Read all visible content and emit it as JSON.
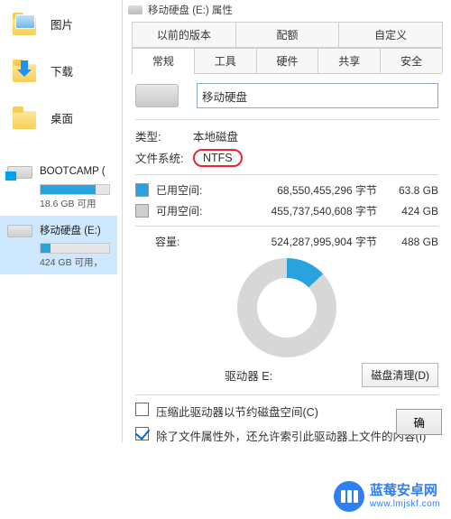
{
  "sidebar": {
    "items": [
      {
        "label": "图片"
      },
      {
        "label": "下载"
      },
      {
        "label": "桌面"
      }
    ],
    "drives": [
      {
        "name": "BOOTCAMP (",
        "sub": "18.6 GB 可用",
        "fill": 80,
        "selected": false,
        "hasWin": true
      },
      {
        "name": "移动硬盘 (E:)",
        "sub": "424 GB 可用，",
        "fill": 14,
        "selected": true,
        "hasWin": false
      }
    ]
  },
  "window": {
    "title": "移动硬盘 (E:) 属性"
  },
  "tabs_top": [
    "以前的版本",
    "配额",
    "自定义"
  ],
  "tabs_bottom": [
    "常规",
    "工具",
    "硬件",
    "共享",
    "安全"
  ],
  "active_tab": "常规",
  "general": {
    "name_value": "移动硬盘",
    "type_label": "类型:",
    "type_value": "本地磁盘",
    "fs_label": "文件系统:",
    "fs_value": "NTFS",
    "used_label": "已用空间:",
    "used_bytes": "68,550,455,296 字节",
    "used_gb": "63.8 GB",
    "free_label": "可用空间:",
    "free_bytes": "455,737,540,608 字节",
    "free_gb": "424 GB",
    "cap_label": "容量:",
    "cap_bytes": "524,287,995,904 字节",
    "cap_gb": "488 GB",
    "drive_name": "驱动器 E:",
    "cleanup_btn": "磁盘清理(D)",
    "chk_compress": "压缩此驱动器以节约磁盘空间(C)",
    "chk_index": "除了文件属性外，还允许索引此驱动器上文件的内容(I)",
    "ok_btn": "确"
  },
  "watermark": {
    "brand": "蓝莓安卓网",
    "url": "www.lmjskf.com"
  }
}
